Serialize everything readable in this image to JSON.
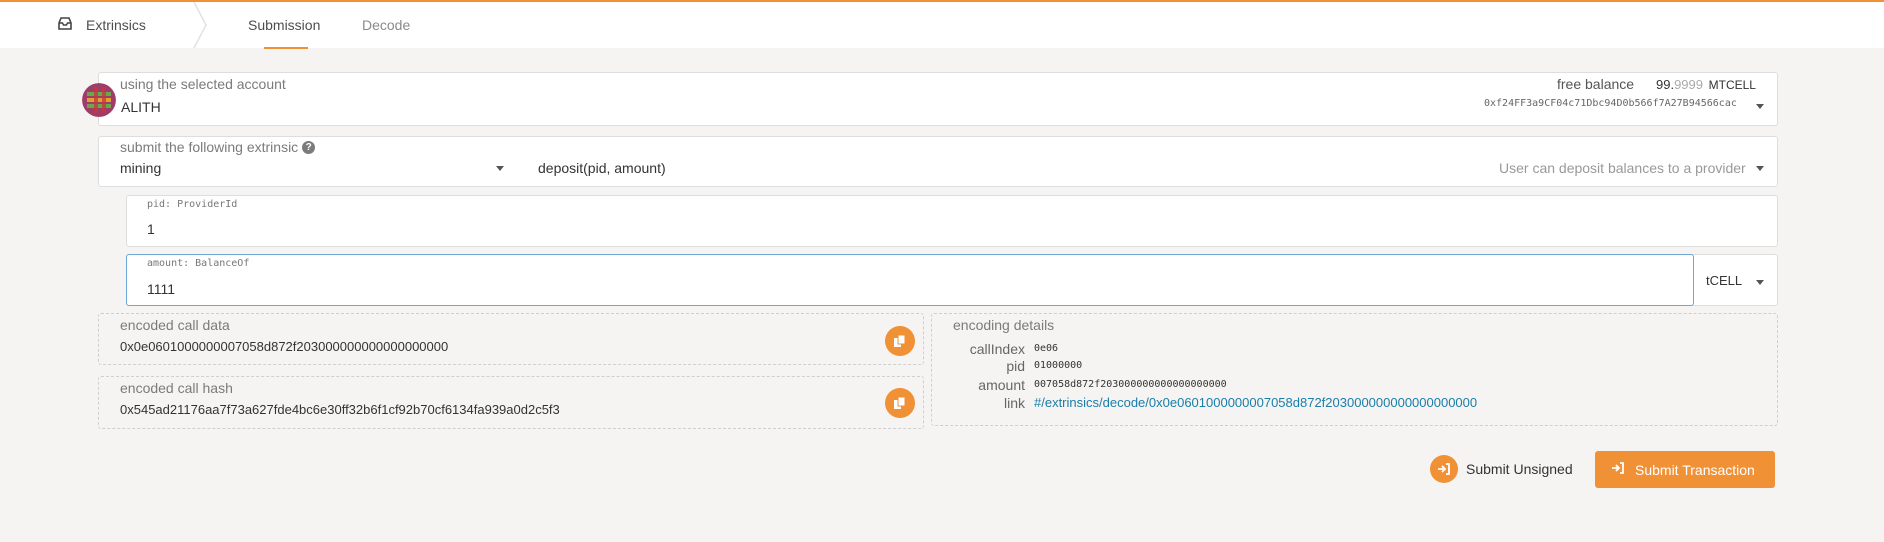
{
  "nav": {
    "brand_label": "Extrinsics",
    "tabs": [
      {
        "label": "Submission",
        "active": true
      },
      {
        "label": "Decode",
        "active": false
      }
    ]
  },
  "account": {
    "label": "using the selected account",
    "name": "ALITH",
    "balance_label": "free balance",
    "balance_int": "99.",
    "balance_frac": "9999",
    "balance_unit": "MTCELL",
    "address": "0xf24FF3a9CF04c71Dbc94D0b566f7A27B94566cac"
  },
  "extrinsic": {
    "label": "submit the following extrinsic",
    "pallet": "mining",
    "call": "deposit(pid, amount)",
    "description": "User can deposit balances to a provider"
  },
  "params": {
    "pid": {
      "label": "pid: ProviderId",
      "value": "1"
    },
    "amount": {
      "label": "amount: BalanceOf",
      "value": "1111",
      "unit": "tCELL"
    }
  },
  "encoded": {
    "call_data_label": "encoded call data",
    "call_data": "0x0e0601000000007058d872f203000000000000000000",
    "call_hash_label": "encoded call hash",
    "call_hash": "0x545ad21176aa7f73a627fde4bc6e30ff32b6f1cf92b70cf6134fa939a0d2c5f3"
  },
  "details": {
    "title": "encoding details",
    "rows": [
      {
        "key": "callIndex",
        "value": "0e06"
      },
      {
        "key": "pid",
        "value": "01000000"
      },
      {
        "key": "amount",
        "value": "007058d872f203000000000000000000"
      },
      {
        "key": "link",
        "value": "#/extrinsics/decode/0x0e0601000000007058d872f203000000000000000000"
      }
    ]
  },
  "actions": {
    "unsigned_label": "Submit Unsigned",
    "submit_label": "Submit Transaction"
  },
  "colors": {
    "accent": "#f19135",
    "link": "#1a7ea8"
  }
}
